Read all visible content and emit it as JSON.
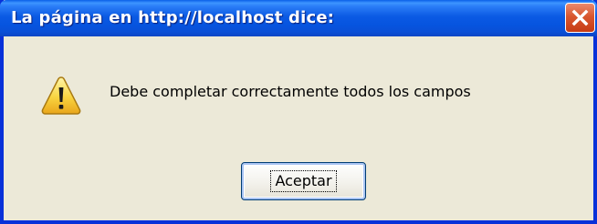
{
  "dialog": {
    "title": "La página en http://localhost dice:",
    "message": "Debe completar correctamente todos los campos",
    "ok_label": "Aceptar",
    "icon": "warning-icon",
    "close_icon": "close-icon"
  },
  "colors": {
    "titlebar": "#0b5ae4",
    "frame": "#0831d9",
    "body": "#ece9d8",
    "close_button": "#d9572f",
    "warning_fill": "#f6c22b"
  }
}
